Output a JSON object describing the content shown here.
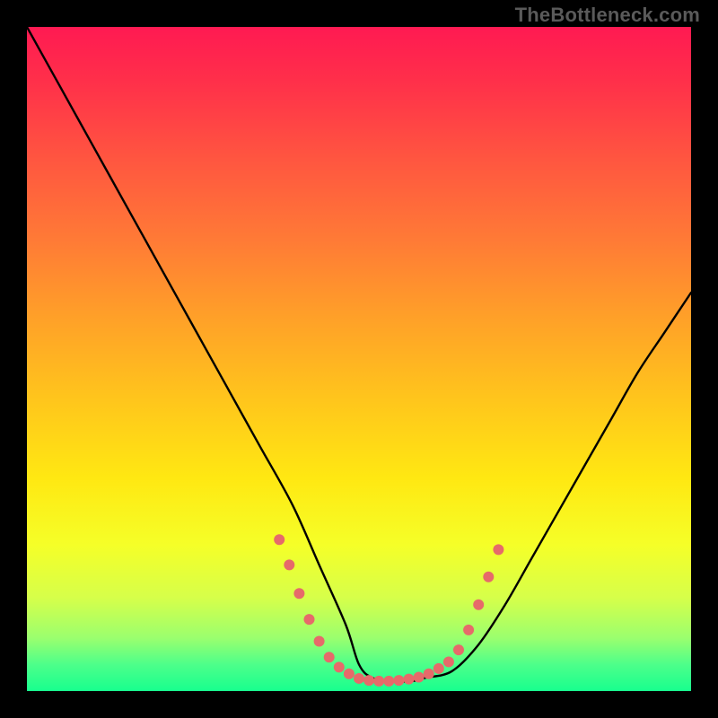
{
  "watermark": "TheBottleneck.com",
  "chart_data": {
    "type": "line",
    "title": "",
    "xlabel": "",
    "ylabel": "",
    "xlim": [
      0,
      100
    ],
    "ylim": [
      0,
      100
    ],
    "grid": false,
    "legend": false,
    "series": [
      {
        "name": "curve",
        "x": [
          0,
          5,
          10,
          15,
          20,
          25,
          30,
          35,
          40,
          44,
          48,
          50,
          52,
          55,
          58,
          60,
          64,
          68,
          72,
          76,
          80,
          84,
          88,
          92,
          96,
          100
        ],
        "values": [
          100,
          91,
          82,
          73,
          64,
          55,
          46,
          37,
          28,
          19,
          10,
          4,
          2,
          1.5,
          1.5,
          2,
          3,
          7,
          13,
          20,
          27,
          34,
          41,
          48,
          54,
          60
        ]
      }
    ],
    "markers": [
      {
        "x": 38.0,
        "y": 22.8
      },
      {
        "x": 39.5,
        "y": 19.0
      },
      {
        "x": 41.0,
        "y": 14.7
      },
      {
        "x": 42.5,
        "y": 10.8
      },
      {
        "x": 44.0,
        "y": 7.5
      },
      {
        "x": 45.5,
        "y": 5.1
      },
      {
        "x": 47.0,
        "y": 3.6
      },
      {
        "x": 48.5,
        "y": 2.6
      },
      {
        "x": 50.0,
        "y": 1.9
      },
      {
        "x": 51.5,
        "y": 1.6
      },
      {
        "x": 53.0,
        "y": 1.5
      },
      {
        "x": 54.5,
        "y": 1.5
      },
      {
        "x": 56.0,
        "y": 1.6
      },
      {
        "x": 57.5,
        "y": 1.8
      },
      {
        "x": 59.0,
        "y": 2.1
      },
      {
        "x": 60.5,
        "y": 2.6
      },
      {
        "x": 62.0,
        "y": 3.4
      },
      {
        "x": 63.5,
        "y": 4.4
      },
      {
        "x": 65.0,
        "y": 6.2
      },
      {
        "x": 66.5,
        "y": 9.2
      },
      {
        "x": 68.0,
        "y": 13.0
      },
      {
        "x": 69.5,
        "y": 17.2
      },
      {
        "x": 71.0,
        "y": 21.3
      }
    ],
    "marker_style": {
      "color": "#e66a6a",
      "radius": 6
    },
    "gradient_stops": [
      {
        "pos": 0,
        "color": "#ff1a52"
      },
      {
        "pos": 8,
        "color": "#ff2f4a"
      },
      {
        "pos": 20,
        "color": "#ff5640"
      },
      {
        "pos": 32,
        "color": "#ff7a36"
      },
      {
        "pos": 44,
        "color": "#ffa128"
      },
      {
        "pos": 56,
        "color": "#ffc51c"
      },
      {
        "pos": 68,
        "color": "#ffe812"
      },
      {
        "pos": 78,
        "color": "#f5ff28"
      },
      {
        "pos": 86,
        "color": "#d6ff4a"
      },
      {
        "pos": 92,
        "color": "#9bff6e"
      },
      {
        "pos": 96,
        "color": "#4dff8a"
      },
      {
        "pos": 100,
        "color": "#18ff8e"
      }
    ]
  }
}
